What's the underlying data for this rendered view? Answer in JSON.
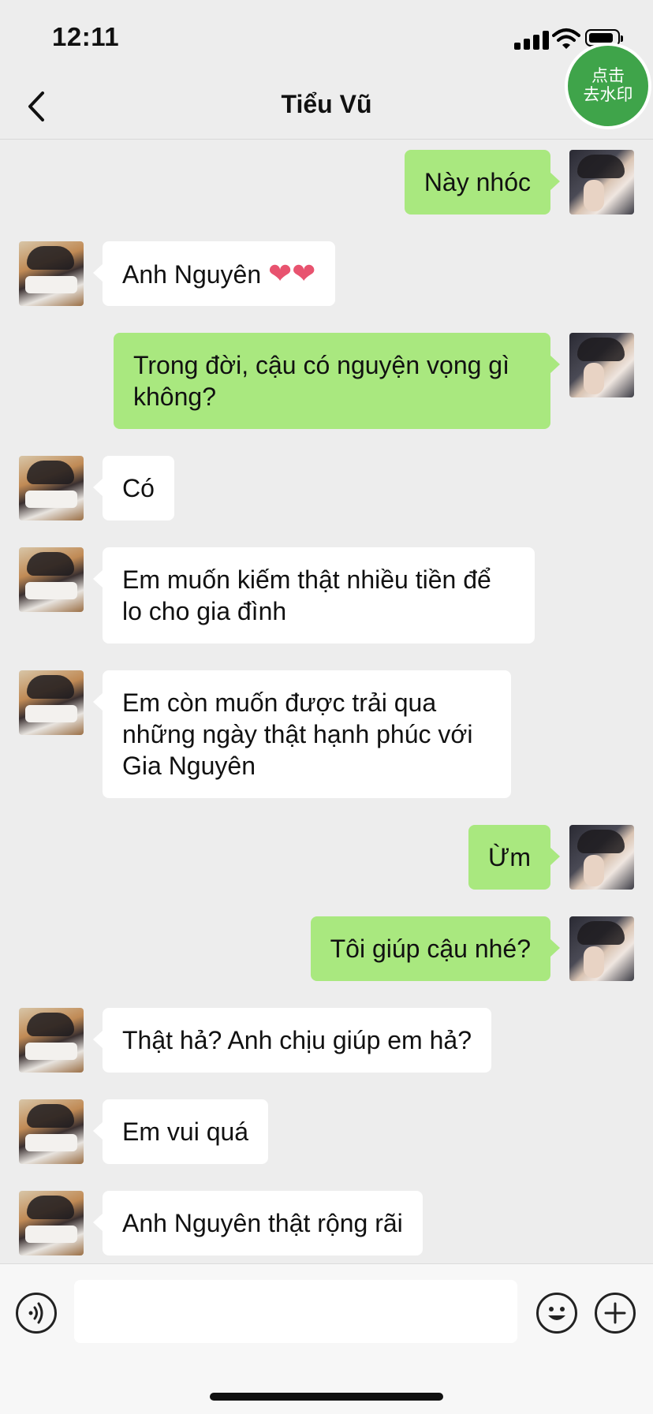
{
  "status_bar": {
    "time": "12:11"
  },
  "header": {
    "title": "Tiểu Vũ",
    "back_icon": "chevron-left-icon"
  },
  "watermark_button": {
    "label": "点击\n去水印",
    "color": "#3fa44a"
  },
  "messages": [
    {
      "from": "me",
      "text": "Này nhóc"
    },
    {
      "from": "other",
      "text": "Anh Nguyên ",
      "emoji": "❤❤"
    },
    {
      "from": "me",
      "text": "Trong đời, cậu có nguyện vọng gì\nkhông?"
    },
    {
      "from": "other",
      "text": "Có"
    },
    {
      "from": "other",
      "text": "Em muốn kiếm thật nhiều tiền để\nlo cho gia đình"
    },
    {
      "from": "other",
      "text": "Em còn muốn được trải qua\nnhững ngày thật hạnh phúc với\nGia Nguyên"
    },
    {
      "from": "me",
      "text": "Ừm"
    },
    {
      "from": "me",
      "text": "Tôi giúp cậu nhé?"
    },
    {
      "from": "other",
      "text": "Thật hả? Anh chịu giúp em hả?"
    },
    {
      "from": "other",
      "text": "Em vui quá"
    },
    {
      "from": "other",
      "text": "Anh Nguyên thật rộng rãi"
    }
  ],
  "colors": {
    "background": "#ededed",
    "my_bubble": "#a9e87f",
    "other_bubble": "#ffffff"
  },
  "input_bar": {
    "voice_icon": "voice-icon",
    "emoji_icon": "emoji-icon",
    "plus_icon": "plus-icon"
  }
}
